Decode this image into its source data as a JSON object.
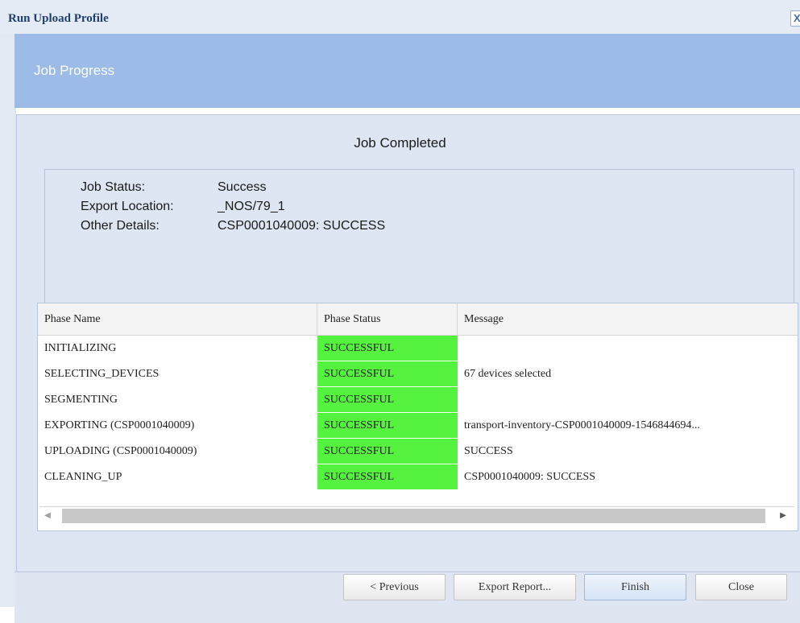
{
  "window": {
    "title": "Run Upload Profile",
    "close_glyph": "X"
  },
  "header": {
    "title": "Job Progress"
  },
  "summary": {
    "heading": "Job Completed",
    "fields": [
      {
        "label": "Job Status:",
        "value": "Success"
      },
      {
        "label": "Export Location:",
        "value": "_NOS/79_1"
      },
      {
        "label": "Other Details:",
        "value": "CSP0001040009: SUCCESS"
      }
    ]
  },
  "table": {
    "columns": [
      "Phase Name",
      "Phase Status",
      "Message"
    ],
    "rows": [
      {
        "phase": "INITIALIZING",
        "status": "SUCCESSFUL",
        "message": ""
      },
      {
        "phase": "SELECTING_DEVICES",
        "status": "SUCCESSFUL",
        "message": "67 devices selected"
      },
      {
        "phase": "SEGMENTING",
        "status": "SUCCESSFUL",
        "message": ""
      },
      {
        "phase": "EXPORTING (CSP0001040009)",
        "status": "SUCCESSFUL",
        "message": "transport-inventory-CSP0001040009-1546844694..."
      },
      {
        "phase": "UPLOADING (CSP0001040009)",
        "status": "SUCCESSFUL",
        "message": "SUCCESS"
      },
      {
        "phase": "CLEANING_UP",
        "status": "SUCCESSFUL",
        "message": "CSP0001040009: SUCCESS"
      }
    ],
    "status_color": "#55f23f"
  },
  "icons": {
    "scroll_left": "scroll-left-arrow-icon",
    "scroll_right": "scroll-right-arrow-icon",
    "close": "close-icon"
  },
  "buttons": {
    "previous": "< Previous",
    "export_report": "Export Report...",
    "finish": "Finish",
    "close": "Close"
  },
  "colors": {
    "header_band": "#9cbbe6",
    "panel_background": "#dde6f2",
    "title_text": "#1f3f6e"
  }
}
